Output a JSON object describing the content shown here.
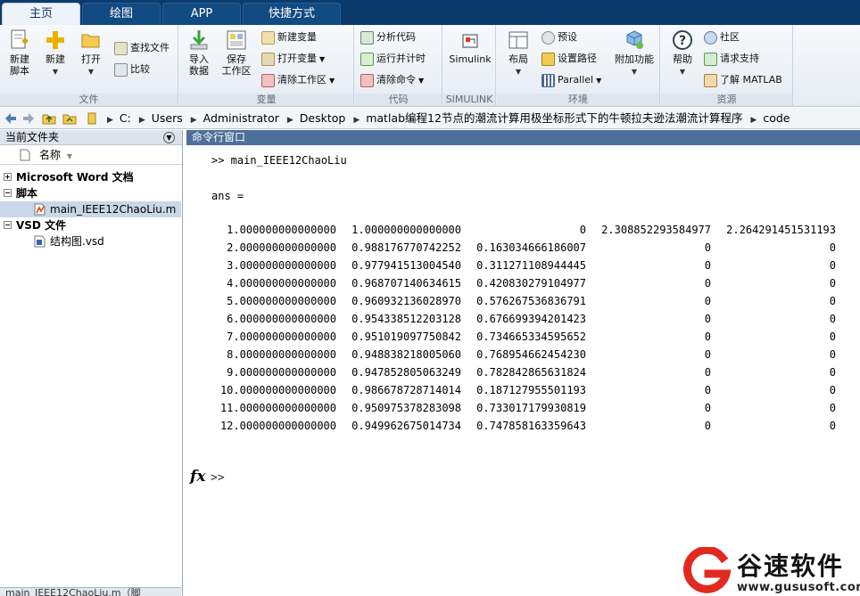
{
  "tabs": [
    {
      "label": "主页",
      "active": true
    },
    {
      "label": "绘图",
      "active": false
    },
    {
      "label": "APP",
      "active": false
    },
    {
      "label": "快捷方式",
      "active": false
    }
  ],
  "ribbon": {
    "file_group": {
      "label": "文件",
      "new_script": "新建\n脚本",
      "new": "新建",
      "open": "打开",
      "find_files": "查找文件",
      "compare": "比较"
    },
    "variable_group": {
      "label": "变量",
      "import_data": "导入\n数据",
      "save_workspace": "保存\n工作区",
      "new_variable": "新建变量",
      "open_variable": "打开变量",
      "clear_workspace": "清除工作区"
    },
    "code_group": {
      "label": "代码",
      "analyze_code": "分析代码",
      "run_and_time": "运行并计时",
      "clear_commands": "清除命令"
    },
    "simulink_group": {
      "label": "SIMULINK",
      "simulink": "Simulink"
    },
    "env_group": {
      "label": "环境",
      "layout": "布局",
      "preferences": "预设",
      "set_path": "设置路径",
      "parallel": "Parallel",
      "addons": "附加功能"
    },
    "resources_group": {
      "label": "资源",
      "help": "帮助",
      "community": "社区",
      "request_support": "请求支持",
      "learn_matlab": "了解 MATLAB"
    }
  },
  "address": {
    "crumbs": [
      "C:",
      "Users",
      "Administrator",
      "Desktop",
      "matlab编程12节点的潮流计算用极坐标形式下的牛顿拉夫逊法潮流计算程序",
      "code"
    ]
  },
  "left_pane": {
    "title": "当前文件夹",
    "col_name": "名称",
    "items": [
      {
        "label": "Microsoft Word 文档",
        "bold": true,
        "kind": "group"
      },
      {
        "label": "脚本",
        "bold": true,
        "kind": "group"
      },
      {
        "label": "main_IEEE12ChaoLiu.m",
        "bold": false,
        "kind": "m-file"
      },
      {
        "label": "VSD 文件",
        "bold": true,
        "kind": "group"
      },
      {
        "label": "结构图.vsd",
        "bold": false,
        "kind": "vsd-file"
      }
    ],
    "status": "main_IEEE12ChaoLiu.m（脚"
  },
  "command_window": {
    "title": "命令行窗口",
    "command": ">> main_IEEE12ChaoLiu",
    "ans_label": "ans =",
    "rows": [
      [
        "1.000000000000000",
        "1.000000000000000",
        "0",
        "2.308852293584977",
        "2.264291451531193"
      ],
      [
        "2.000000000000000",
        "0.988176770742252",
        "0.163034666186007",
        "0",
        "0"
      ],
      [
        "3.000000000000000",
        "0.977941513004540",
        "0.311271108944445",
        "0",
        "0"
      ],
      [
        "4.000000000000000",
        "0.968707140634615",
        "0.420830279104977",
        "0",
        "0"
      ],
      [
        "5.000000000000000",
        "0.960932136028970",
        "0.576267536836791",
        "0",
        "0"
      ],
      [
        "6.000000000000000",
        "0.954338512203128",
        "0.676699394201423",
        "0",
        "0"
      ],
      [
        "7.000000000000000",
        "0.951019097750842",
        "0.734665334595652",
        "0",
        "0"
      ],
      [
        "8.000000000000000",
        "0.948838218005060",
        "0.768954662454230",
        "0",
        "0"
      ],
      [
        "9.000000000000000",
        "0.947852805063249",
        "0.782842865631824",
        "0",
        "0"
      ],
      [
        "10.000000000000000",
        "0.986678728714014",
        "0.187127955501193",
        "0",
        "0"
      ],
      [
        "11.000000000000000",
        "0.950975378283098",
        "0.733017179930819",
        "0",
        "0"
      ],
      [
        "12.000000000000000",
        "0.949962675014734",
        "0.747858163359643",
        "0",
        "0"
      ]
    ],
    "fx": "fx",
    "prompt": ">>"
  },
  "watermark": {
    "brand": "谷速软件",
    "url": "www.gususoft.com"
  }
}
